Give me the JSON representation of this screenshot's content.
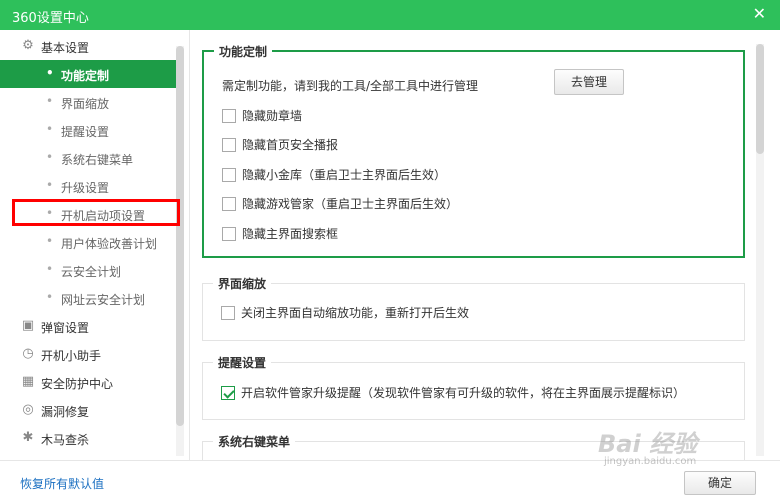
{
  "window": {
    "title": "360设置中心"
  },
  "sidebar": {
    "categories": [
      {
        "label": "基本设置",
        "icon": "gear-icon"
      },
      {
        "label": "弹窗设置",
        "icon": "popup-icon"
      },
      {
        "label": "开机小助手",
        "icon": "timer-icon"
      },
      {
        "label": "安全防护中心",
        "icon": "grid-icon"
      },
      {
        "label": "漏洞修复",
        "icon": "patch-icon"
      },
      {
        "label": "木马查杀",
        "icon": "bug-icon"
      }
    ],
    "sub_items": [
      {
        "label": "功能定制",
        "active": true
      },
      {
        "label": "界面缩放"
      },
      {
        "label": "提醒设置"
      },
      {
        "label": "系统右键菜单"
      },
      {
        "label": "升级设置"
      },
      {
        "label": "开机启动项设置"
      },
      {
        "label": "用户体验改善计划"
      },
      {
        "label": "云安全计划"
      },
      {
        "label": "网址云安全计划"
      }
    ]
  },
  "main": {
    "custom": {
      "title": "功能定制",
      "desc": "需定制功能，请到我的工具/全部工具中进行管理",
      "manage_button": "去管理",
      "options": [
        {
          "label": "隐藏勋章墙",
          "checked": false
        },
        {
          "label": "隐藏首页安全播报",
          "checked": false
        },
        {
          "label": "隐藏小金库（重启卫士主界面后生效）",
          "checked": false
        },
        {
          "label": "隐藏游戏管家（重启卫士主界面后生效）",
          "checked": false
        },
        {
          "label": "隐藏主界面搜索框",
          "checked": false
        }
      ]
    },
    "zoom": {
      "title": "界面缩放",
      "option": {
        "label": "关闭主界面自动缩放功能，重新打开后生效",
        "checked": false
      }
    },
    "remind": {
      "title": "提醒设置",
      "option": {
        "label": "开启软件管家升级提醒（发现软件管家有可升级的软件，将在主界面展示提醒标识）",
        "checked": true
      }
    },
    "context_menu": {
      "title": "系统右键菜单"
    }
  },
  "footer": {
    "reset_label": "恢复所有默认值",
    "ok_label": "确定"
  },
  "watermark": {
    "logo": "Bai 经验",
    "url": "jingyan.baidu.com"
  },
  "colors": {
    "titlebar": "#2ec05b",
    "active": "#1d9c47",
    "highlight": "#ff0000",
    "link": "#1a6fc1"
  }
}
